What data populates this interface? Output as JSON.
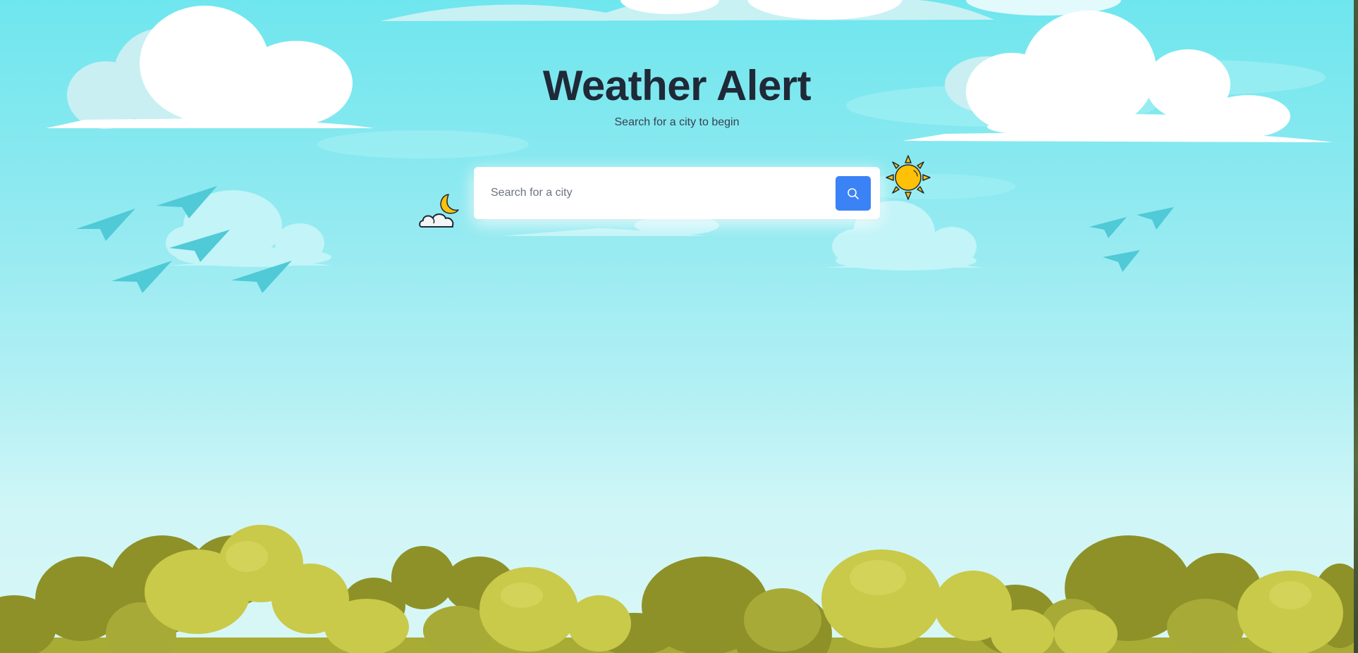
{
  "page": {
    "title": "Weather Alert",
    "subtitle": "Search for a city to begin"
  },
  "search": {
    "placeholder": "Search for a city",
    "value": "",
    "button_icon": "search-icon"
  },
  "decorations": {
    "left_icon": "moon-cloud-icon",
    "right_icon": "sun-icon",
    "background": "sky-clouds-birds-bushes-illustration"
  },
  "colors": {
    "sky_top": "#6fe6ee",
    "sky_bottom": "#d8f7f6",
    "title": "#1f2937",
    "button": "#3b82f6",
    "bush_dark": "#8e9128",
    "bush_light": "#c9c94a",
    "sun": "#ffc107"
  }
}
